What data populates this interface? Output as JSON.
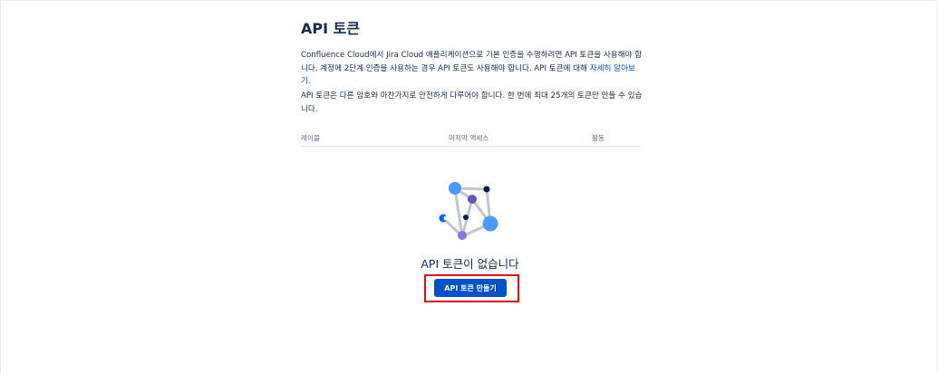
{
  "page": {
    "title": "API 토큰",
    "description": {
      "line1_part": "Confluence Cloud에서 Jira Cloud 애플리케이션으로 기본 인증을 수행하려면 API 토큰을 사용해야 합니다. 계정에 2단계 인증을 사용하는 경우 API 토큰도 사용해야 합니다. API 토큰에 대해 ",
      "learn_more_link": "자세히 알아보기",
      "end": "."
    },
    "security_note": "API 토큰은 다른 암호와 마찬가지로 안전하게 다루어야 합니다. 한 번에 최대 25개의 토큰만 만들 수 있습니다."
  },
  "table": {
    "headers": {
      "label": "레이블",
      "last_accessed": "마지막 액세스",
      "action": "활동"
    }
  },
  "empty_state": {
    "title": "API 토큰이 없습니다",
    "create_button": "API 토큰 만들기"
  },
  "colors": {
    "primary": "#0052cc",
    "highlight": "#e0101a"
  }
}
